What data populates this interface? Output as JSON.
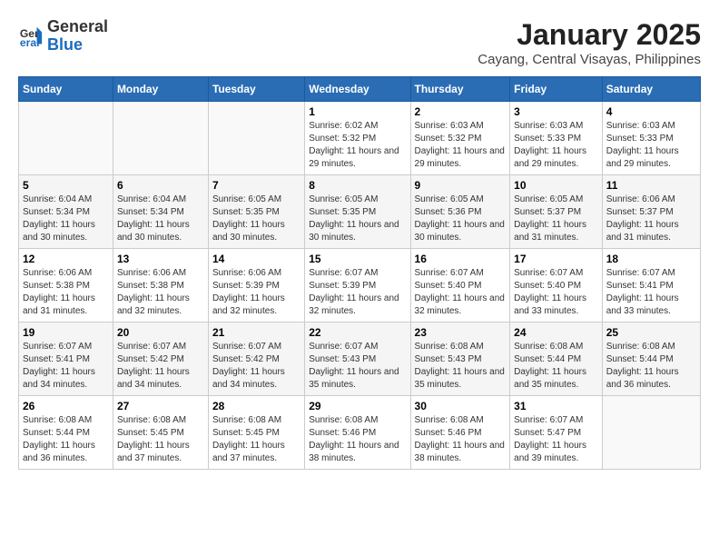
{
  "logo": {
    "line1": "General",
    "line2": "Blue"
  },
  "title": "January 2025",
  "subtitle": "Cayang, Central Visayas, Philippines",
  "days_of_week": [
    "Sunday",
    "Monday",
    "Tuesday",
    "Wednesday",
    "Thursday",
    "Friday",
    "Saturday"
  ],
  "weeks": [
    [
      {
        "day": "",
        "sunrise": "",
        "sunset": "",
        "daylight": ""
      },
      {
        "day": "",
        "sunrise": "",
        "sunset": "",
        "daylight": ""
      },
      {
        "day": "",
        "sunrise": "",
        "sunset": "",
        "daylight": ""
      },
      {
        "day": "1",
        "sunrise": "6:02 AM",
        "sunset": "5:32 PM",
        "daylight": "11 hours and 29 minutes."
      },
      {
        "day": "2",
        "sunrise": "6:03 AM",
        "sunset": "5:32 PM",
        "daylight": "11 hours and 29 minutes."
      },
      {
        "day": "3",
        "sunrise": "6:03 AM",
        "sunset": "5:33 PM",
        "daylight": "11 hours and 29 minutes."
      },
      {
        "day": "4",
        "sunrise": "6:03 AM",
        "sunset": "5:33 PM",
        "daylight": "11 hours and 29 minutes."
      }
    ],
    [
      {
        "day": "5",
        "sunrise": "6:04 AM",
        "sunset": "5:34 PM",
        "daylight": "11 hours and 30 minutes."
      },
      {
        "day": "6",
        "sunrise": "6:04 AM",
        "sunset": "5:34 PM",
        "daylight": "11 hours and 30 minutes."
      },
      {
        "day": "7",
        "sunrise": "6:05 AM",
        "sunset": "5:35 PM",
        "daylight": "11 hours and 30 minutes."
      },
      {
        "day": "8",
        "sunrise": "6:05 AM",
        "sunset": "5:35 PM",
        "daylight": "11 hours and 30 minutes."
      },
      {
        "day": "9",
        "sunrise": "6:05 AM",
        "sunset": "5:36 PM",
        "daylight": "11 hours and 30 minutes."
      },
      {
        "day": "10",
        "sunrise": "6:05 AM",
        "sunset": "5:37 PM",
        "daylight": "11 hours and 31 minutes."
      },
      {
        "day": "11",
        "sunrise": "6:06 AM",
        "sunset": "5:37 PM",
        "daylight": "11 hours and 31 minutes."
      }
    ],
    [
      {
        "day": "12",
        "sunrise": "6:06 AM",
        "sunset": "5:38 PM",
        "daylight": "11 hours and 31 minutes."
      },
      {
        "day": "13",
        "sunrise": "6:06 AM",
        "sunset": "5:38 PM",
        "daylight": "11 hours and 32 minutes."
      },
      {
        "day": "14",
        "sunrise": "6:06 AM",
        "sunset": "5:39 PM",
        "daylight": "11 hours and 32 minutes."
      },
      {
        "day": "15",
        "sunrise": "6:07 AM",
        "sunset": "5:39 PM",
        "daylight": "11 hours and 32 minutes."
      },
      {
        "day": "16",
        "sunrise": "6:07 AM",
        "sunset": "5:40 PM",
        "daylight": "11 hours and 32 minutes."
      },
      {
        "day": "17",
        "sunrise": "6:07 AM",
        "sunset": "5:40 PM",
        "daylight": "11 hours and 33 minutes."
      },
      {
        "day": "18",
        "sunrise": "6:07 AM",
        "sunset": "5:41 PM",
        "daylight": "11 hours and 33 minutes."
      }
    ],
    [
      {
        "day": "19",
        "sunrise": "6:07 AM",
        "sunset": "5:41 PM",
        "daylight": "11 hours and 34 minutes."
      },
      {
        "day": "20",
        "sunrise": "6:07 AM",
        "sunset": "5:42 PM",
        "daylight": "11 hours and 34 minutes."
      },
      {
        "day": "21",
        "sunrise": "6:07 AM",
        "sunset": "5:42 PM",
        "daylight": "11 hours and 34 minutes."
      },
      {
        "day": "22",
        "sunrise": "6:07 AM",
        "sunset": "5:43 PM",
        "daylight": "11 hours and 35 minutes."
      },
      {
        "day": "23",
        "sunrise": "6:08 AM",
        "sunset": "5:43 PM",
        "daylight": "11 hours and 35 minutes."
      },
      {
        "day": "24",
        "sunrise": "6:08 AM",
        "sunset": "5:44 PM",
        "daylight": "11 hours and 35 minutes."
      },
      {
        "day": "25",
        "sunrise": "6:08 AM",
        "sunset": "5:44 PM",
        "daylight": "11 hours and 36 minutes."
      }
    ],
    [
      {
        "day": "26",
        "sunrise": "6:08 AM",
        "sunset": "5:44 PM",
        "daylight": "11 hours and 36 minutes."
      },
      {
        "day": "27",
        "sunrise": "6:08 AM",
        "sunset": "5:45 PM",
        "daylight": "11 hours and 37 minutes."
      },
      {
        "day": "28",
        "sunrise": "6:08 AM",
        "sunset": "5:45 PM",
        "daylight": "11 hours and 37 minutes."
      },
      {
        "day": "29",
        "sunrise": "6:08 AM",
        "sunset": "5:46 PM",
        "daylight": "11 hours and 38 minutes."
      },
      {
        "day": "30",
        "sunrise": "6:08 AM",
        "sunset": "5:46 PM",
        "daylight": "11 hours and 38 minutes."
      },
      {
        "day": "31",
        "sunrise": "6:07 AM",
        "sunset": "5:47 PM",
        "daylight": "11 hours and 39 minutes."
      },
      {
        "day": "",
        "sunrise": "",
        "sunset": "",
        "daylight": ""
      }
    ]
  ],
  "labels": {
    "sunrise_prefix": "Sunrise: ",
    "sunset_prefix": "Sunset: ",
    "daylight_prefix": "Daylight: "
  }
}
